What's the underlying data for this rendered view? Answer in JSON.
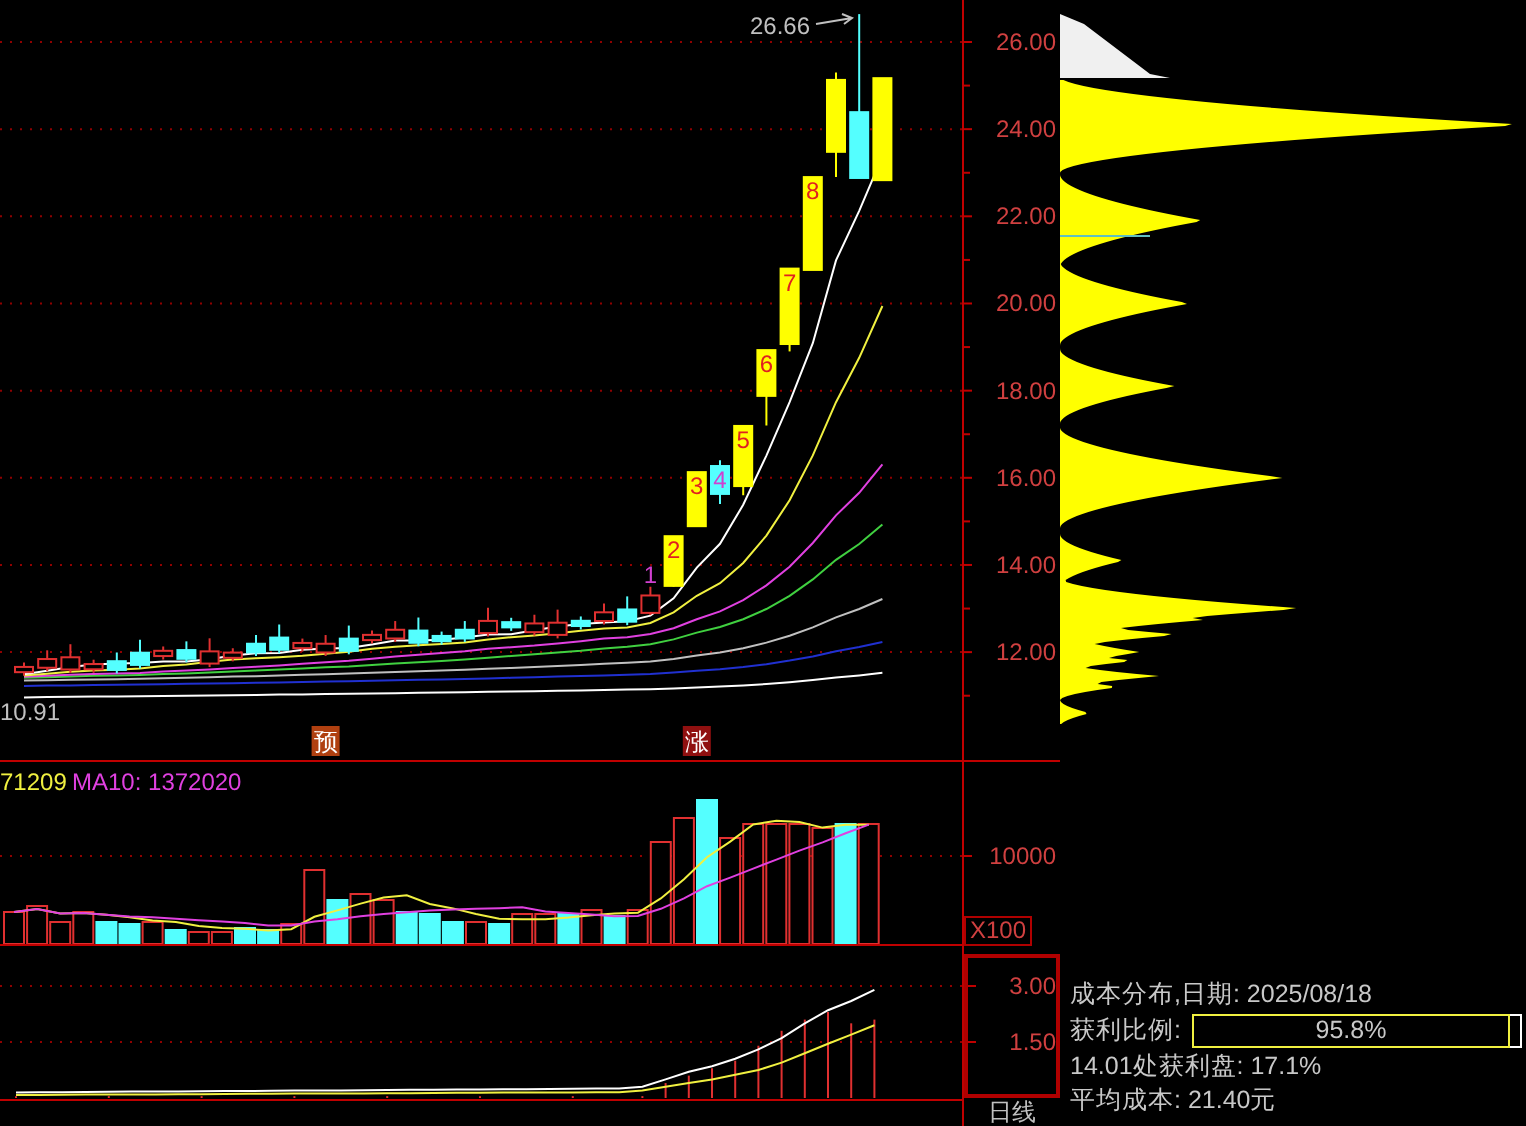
{
  "price_chart": {
    "high_label": "26.66",
    "low_label": "10.91",
    "event_markers": [
      {
        "text": "预",
        "kind": "forecast"
      },
      {
        "text": "涨",
        "kind": "rise"
      }
    ],
    "candle_counts": [
      "1",
      "2",
      "3",
      "4",
      "5",
      "6",
      "7",
      "8"
    ]
  },
  "price_axis": [
    "26.00",
    "24.00",
    "22.00",
    "20.00",
    "18.00",
    "16.00",
    "14.00",
    "12.00"
  ],
  "volume_panel": {
    "legend": [
      {
        "text": "71209",
        "kind": "ma5"
      },
      {
        "text": "MA10: 1372020",
        "kind": "ma10"
      }
    ],
    "axis_label": "10000",
    "unit": "X100"
  },
  "indicator_panel": {
    "axis_labels": [
      "3.00",
      "1.50"
    ]
  },
  "cost_distribution": {
    "title": "成本分布,日期: 2025/08/18",
    "profit_label": "获利比例:",
    "profit_ratio": {
      "text": "95.8%",
      "level": 0.958
    },
    "profit_at_price": "14.01处获利盘: 17.1%",
    "average_cost": "平均成本: 21.40元"
  },
  "period_label": "日线"
}
